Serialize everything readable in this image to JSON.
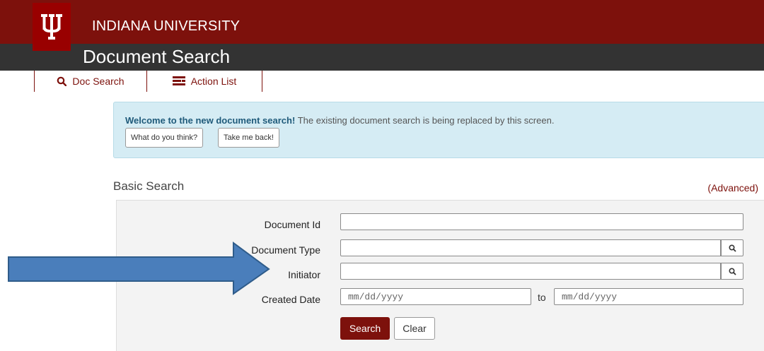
{
  "header": {
    "brand": "INDIANA UNIVERSITY",
    "app_title": "Document Search",
    "logo_icon": "iu-trident-logo",
    "brand_color": "#7d110c",
    "titlebar_color": "#333333"
  },
  "nav": {
    "tabs": [
      {
        "label": "Doc Search",
        "icon": "search-icon"
      },
      {
        "label": "Action List",
        "icon": "list-icon"
      }
    ]
  },
  "banner": {
    "bold_text": "Welcome to the new document search!",
    "text": " The existing document search is being replaced by this screen.",
    "buttons": [
      "What do you think?",
      "Take me back!"
    ],
    "background": "#d5ecf4"
  },
  "search": {
    "heading": "Basic Search",
    "advanced_link": "(Advanced)",
    "fields": {
      "document_id": {
        "label": "Document Id",
        "value": ""
      },
      "document_type": {
        "label": "Document Type",
        "value": ""
      },
      "initiator": {
        "label": "Initiator",
        "value": ""
      },
      "created_date": {
        "label": "Created Date",
        "from_placeholder": "mm/dd/yyyy",
        "to_label": "to",
        "to_placeholder": "mm/dd/yyyy"
      }
    },
    "search_button": "Search",
    "clear_button": "Clear"
  },
  "annotation": {
    "icon": "right-arrow-annotation",
    "color": "#4a7ebb"
  }
}
